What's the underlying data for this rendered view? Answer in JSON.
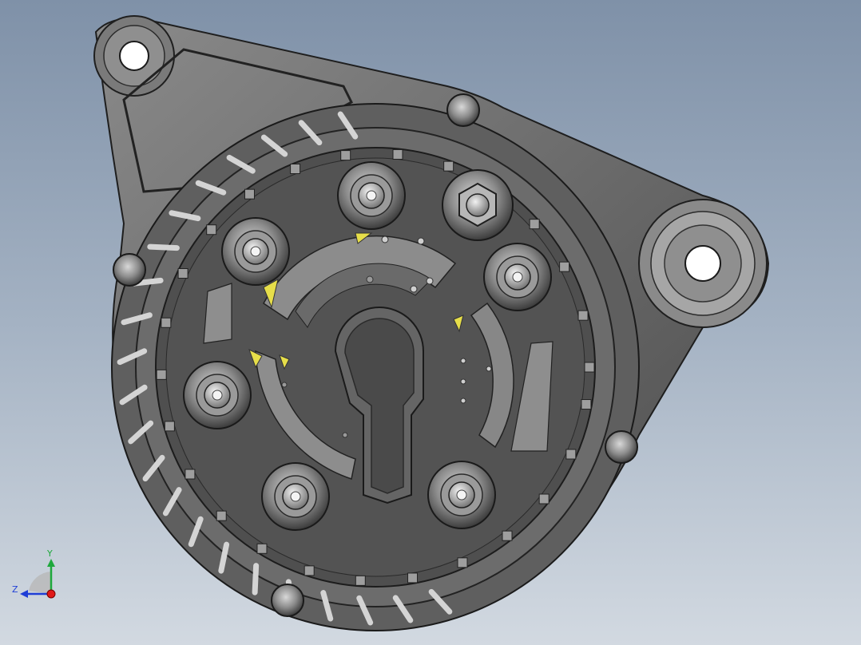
{
  "viewport": {
    "background_top": "#7f91a8",
    "background_bottom": "#d2d9e1",
    "model": "alternator-rear-housing"
  },
  "triad": {
    "y_label": "Y",
    "z_label": "Z",
    "y_color": "#1ea83c",
    "z_color": "#1f3ed6",
    "x_color": "#e01818"
  },
  "colors": {
    "housing_dark": "#3a3a3a",
    "housing_mid": "#6a6a6a",
    "housing_light": "#9a9a9a",
    "face_dark": "#4d4d4d",
    "accent_yellow": "#e6de4a"
  }
}
